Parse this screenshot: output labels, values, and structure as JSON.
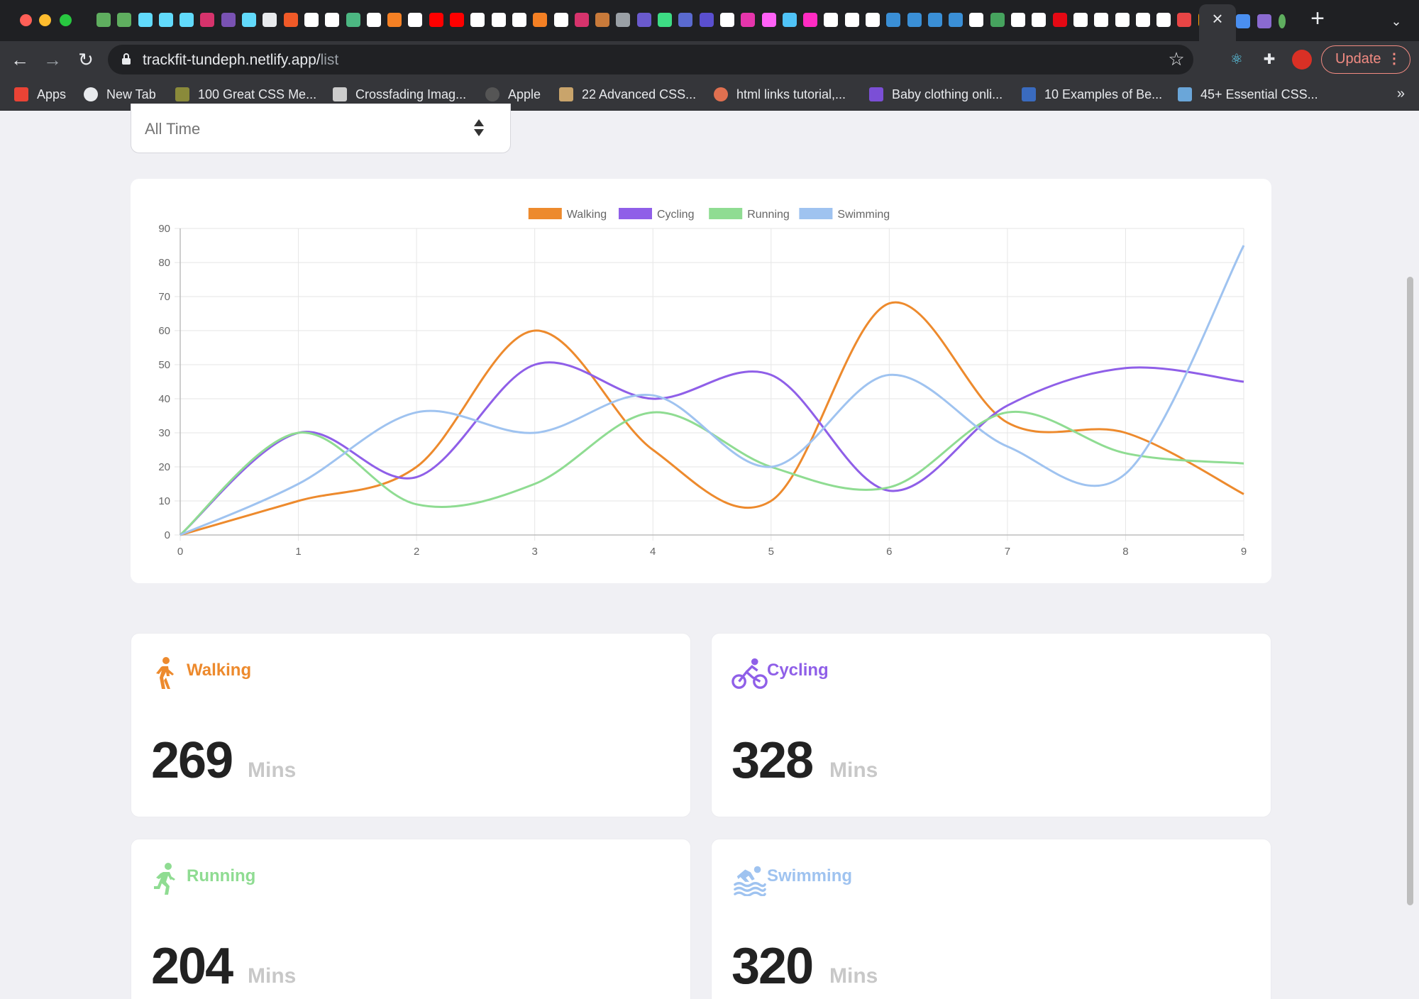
{
  "browser": {
    "url_host": "trackfit-tundeph.netlify.app/",
    "url_path": "list",
    "update_label": "Update",
    "colors": {
      "tabstrip": "#1f2023",
      "toolbar": "#35363a",
      "update": "#f28b82"
    },
    "traffic_lights": [
      "#ff5f57",
      "#febc2e",
      "#28c840"
    ],
    "icons": [
      "close-icon",
      "new-tab-icon",
      "back-icon",
      "forward-icon",
      "reload-icon",
      "lock-icon",
      "bookmark-star-icon",
      "extensions-icon",
      "profile-avatar",
      "more-icon"
    ]
  },
  "bookmarks": [
    {
      "label": "Apps",
      "color": "#ea4335"
    },
    {
      "label": "New Tab",
      "color": "#e8eaed"
    },
    {
      "label": "100 Great CSS Me...",
      "color": "#8a8a3a"
    },
    {
      "label": "Crossfading Imag...",
      "color": "#cccccc"
    },
    {
      "label": "Apple",
      "color": "#555555"
    },
    {
      "label": "22 Advanced CSS...",
      "color": "#c9a46b"
    },
    {
      "label": "html links tutorial,...",
      "color": "#e07050"
    },
    {
      "label": "Baby clothing onli...",
      "color": "#7b4fd6"
    },
    {
      "label": "10 Examples of Be...",
      "color": "#3a6bbf"
    },
    {
      "label": "45+ Essential CSS...",
      "color": "#6aa6d9"
    }
  ],
  "bookmarks_more": "»",
  "filter": {
    "selected": "All Time"
  },
  "chart_data": {
    "type": "line",
    "x": [
      0,
      1,
      2,
      3,
      4,
      5,
      6,
      7,
      8,
      9
    ],
    "ylim": [
      0,
      90
    ],
    "yticks": [
      0,
      10,
      20,
      30,
      40,
      50,
      60,
      70,
      80,
      90
    ],
    "grid": true,
    "legend_position": "top",
    "series": [
      {
        "name": "Walking",
        "color": "#ed8a2d",
        "values": [
          0,
          10,
          20,
          60,
          25,
          10,
          68,
          33,
          30,
          12
        ]
      },
      {
        "name": "Cycling",
        "color": "#8f5fe8",
        "values": [
          0,
          30,
          17,
          50,
          40,
          47,
          13,
          38,
          49,
          45
        ]
      },
      {
        "name": "Running",
        "color": "#8fdc92",
        "values": [
          0,
          30,
          9,
          15,
          36,
          20,
          14,
          36,
          24,
          21
        ]
      },
      {
        "name": "Swimming",
        "color": "#9fc3f0",
        "values": [
          0,
          15,
          36,
          30,
          41,
          20,
          47,
          26,
          18,
          85
        ]
      }
    ]
  },
  "stats": [
    {
      "label": "Walking",
      "value": "269",
      "unit": "Mins",
      "color": "#ed8a2d",
      "icon": "walking-icon"
    },
    {
      "label": "Cycling",
      "value": "328",
      "unit": "Mins",
      "color": "#8f5fe8",
      "icon": "cycling-icon"
    },
    {
      "label": "Running",
      "value": "204",
      "unit": "Mins",
      "color": "#8fdc92",
      "icon": "running-icon"
    },
    {
      "label": "Swimming",
      "value": "320",
      "unit": "Mins",
      "color": "#9fc3f0",
      "icon": "swimming-icon"
    }
  ]
}
